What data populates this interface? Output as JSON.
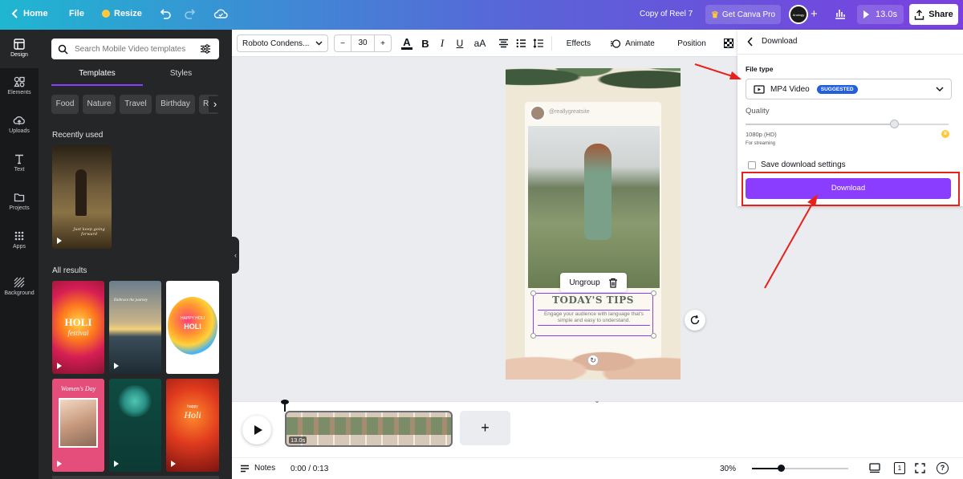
{
  "topbar": {
    "home": "Home",
    "file": "File",
    "resize": "Resize",
    "doc_title": "Copy of Reel 7",
    "get_pro": "Get Canva Pro",
    "avatar_text": "Analogy",
    "duration": "13.0s",
    "share": "Share"
  },
  "rail": {
    "design": "Design",
    "elements": "Elements",
    "uploads": "Uploads",
    "text": "Text",
    "projects": "Projects",
    "apps": "Apps",
    "background": "Background"
  },
  "panel": {
    "search_placeholder": "Search Mobile Video templates",
    "tab_templates": "Templates",
    "tab_styles": "Styles",
    "chips": [
      "Food",
      "Nature",
      "Travel",
      "Birthday",
      "Ra"
    ],
    "recent_heading": "Recently used",
    "recent_caption": "Just keep going forward",
    "all_heading": "All results",
    "results": [
      {
        "title": "HOLI",
        "sub": "festival"
      },
      {
        "title": "Embrace the journey",
        "sub": ""
      },
      {
        "title": "HOLI",
        "sub": "HAPPY HOLI"
      },
      {
        "title": "Women's Day",
        "sub": ""
      },
      {
        "title": "",
        "sub": ""
      },
      {
        "title": "Holi",
        "sub": "happy"
      }
    ]
  },
  "toolbar": {
    "font": "Roboto Condens...",
    "minus": "−",
    "size": "30",
    "plus": "+",
    "effects": "Effects",
    "animate": "Animate",
    "position": "Position"
  },
  "canvas": {
    "handle": "@reallygreatsite",
    "ungroup": "Ungroup",
    "headline": "TODAY'S TIPS",
    "body": "Engage your audience with language that's simple and easy to understand."
  },
  "download": {
    "title": "Download",
    "file_type_label": "File type",
    "file_type_value": "MP4 Video",
    "suggested": "SUGGESTED",
    "quality_label": "Quality",
    "quality_value": "1080p (HD)",
    "quality_note": "For streaming",
    "quality_level": 0.73,
    "save_settings": "Save download settings",
    "button": "Download"
  },
  "timeline": {
    "clip_duration": "13.0s"
  },
  "bottombar": {
    "notes": "Notes",
    "time": "0:00 / 0:13",
    "zoom": "30%",
    "zoom_level": 0.3,
    "pages": "1"
  },
  "colors": {
    "accent": "#8b3dff",
    "annotation": "#e8221b",
    "suggested": "#1f5fe0"
  }
}
